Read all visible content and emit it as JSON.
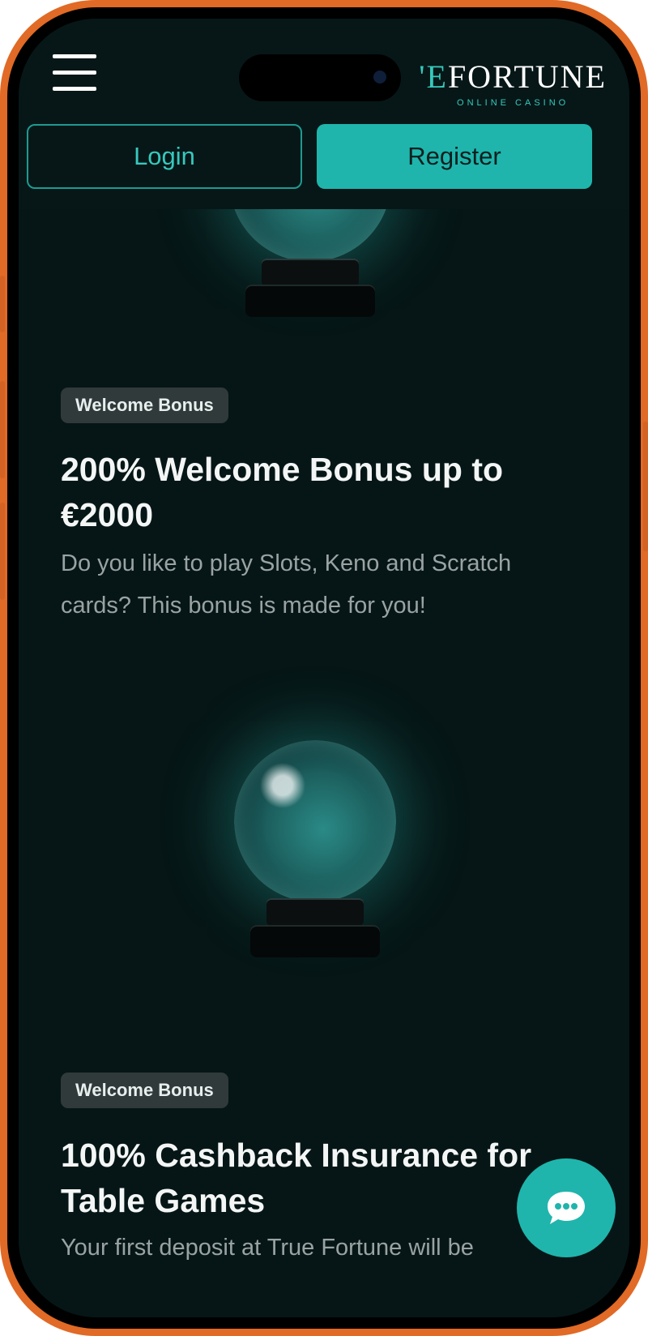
{
  "header": {
    "logo_prefix": "'E",
    "logo_main": "FORTUNE",
    "logo_sub": "ONLINE CASINO",
    "login_label": "Login",
    "register_label": "Register"
  },
  "promos": [
    {
      "badge": "Welcome Bonus",
      "title": "200% Welcome Bonus up to €2000",
      "description": "Do you like to play Slots, Keno and Scratch cards? This bonus is made for you!"
    },
    {
      "badge": "Welcome Bonus",
      "title": "100% Cashback Insurance for Table Games",
      "description": "Your first deposit at True Fortune will be"
    }
  ],
  "icons": {
    "menu": "hamburger-menu-icon",
    "chat": "chat-bubble-icon",
    "orb": "crystal-ball-image"
  },
  "colors": {
    "accent": "#1fb5ac",
    "frame": "#e06a26",
    "background": "#061616"
  }
}
